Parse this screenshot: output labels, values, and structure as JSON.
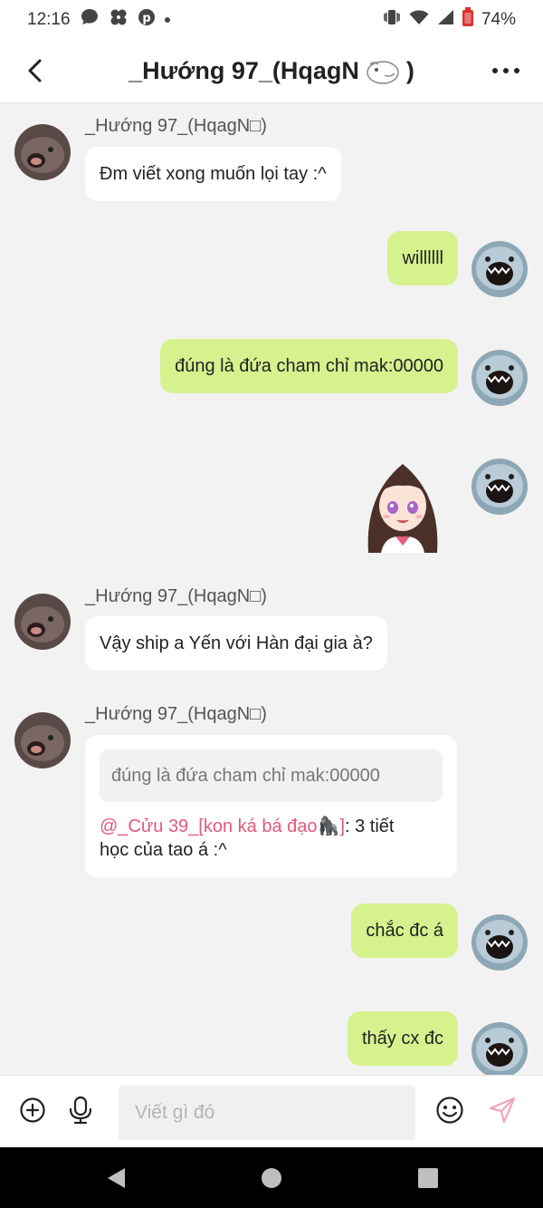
{
  "status_bar": {
    "time": "12:16",
    "battery": "74%",
    "icons": [
      "chat-bubble-icon",
      "pinwheel-icon",
      "pinterest-icon",
      "dot-icon",
      "vibrate-icon",
      "wifi-icon",
      "signal-icon",
      "battery-icon"
    ]
  },
  "header": {
    "title": "_Hướng 97_(HqagN",
    "title_suffix": ")",
    "back_icon": "chevron-left-icon",
    "more_icon": "more-horizontal-icon"
  },
  "messages": [
    {
      "sender": "_Hướng 97_(HqagN□)",
      "text": "Đm viết xong muốn lọi tay :^"
    },
    {
      "text": "willllll"
    },
    {
      "text": "đúng là đứa cham chỉ mak:00000"
    },
    {
      "sticker": "anime-girl-sticker"
    },
    {
      "sender": "_Hướng 97_(HqagN□)",
      "text": "Vậy ship a Yến với Hàn đại gia à?"
    },
    {
      "sender": "_Hướng 97_(HqagN□)",
      "quote": "đúng là đứa cham chỉ mak:00000",
      "mention": "@_Cửu 39_[kon ká bá đạo",
      "mention_end": "]",
      "text_line1": ": 3 tiết",
      "text_line2": "học của tao á :^"
    },
    {
      "text": "chắc đc á"
    },
    {
      "text": "thấy cx đc"
    }
  ],
  "input_bar": {
    "placeholder": "Viết gì đó",
    "icons": [
      "add-circle-icon",
      "microphone-icon",
      "emoji-icon",
      "send-icon"
    ]
  },
  "nav_bar": {
    "icons": [
      "back-triangle-icon",
      "home-circle-icon",
      "recents-square-icon"
    ]
  },
  "colors": {
    "outgoing_bubble": "#d6f28e",
    "incoming_bubble": "#ffffff",
    "background": "#f2f2f2",
    "mention": "#e05a7a"
  }
}
